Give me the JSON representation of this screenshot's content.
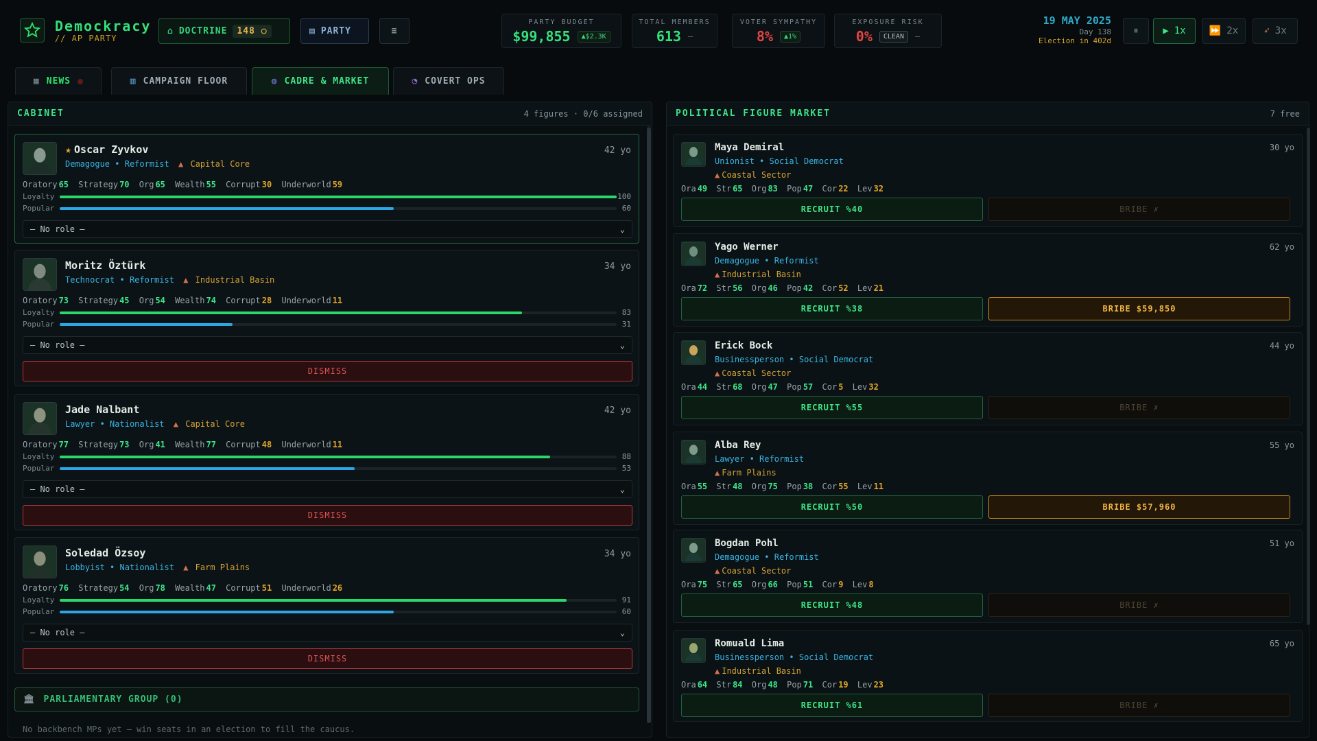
{
  "app": {
    "title": "Demockracy",
    "subtitle": "// AP PARTY"
  },
  "toolbar": {
    "doctrine_label": "DOCTRINE",
    "doctrine_points": "148",
    "party_label": "PARTY"
  },
  "stats": {
    "budget": {
      "label": "PARTY BUDGET",
      "value": "$99,855",
      "chip": "▲$2.3K"
    },
    "members": {
      "label": "TOTAL MEMBERS",
      "value": "613",
      "chip": "–"
    },
    "sympathy": {
      "label": "VOTER SYMPATHY",
      "value": "8%",
      "chip": "▲1%"
    },
    "exposure": {
      "label": "EXPOSURE RISK",
      "value": "0%",
      "chip": "CLEAN",
      "dash": "–"
    }
  },
  "date": {
    "main": "19 MAY 2025",
    "day": "Day 138",
    "election": "Election in 402d"
  },
  "speed": {
    "pause": "⏸",
    "s1": "1x",
    "s2": "2x",
    "s3": "3x"
  },
  "tabs": [
    {
      "label": "NEWS"
    },
    {
      "label": "CAMPAIGN FLOOR"
    },
    {
      "label": "CADRE & MARKET"
    },
    {
      "label": "COVERT OPS"
    }
  ],
  "cabinet": {
    "title": "CABINET",
    "meta": "4 figures · 0/6 assigned",
    "stat_labels": {
      "oratory": "Oratory",
      "strategy": "Strategy",
      "org": "Org",
      "wealth": "Wealth",
      "corrupt": "Corrupt",
      "underworld": "Underworld"
    },
    "bar_labels": {
      "loyalty": "Loyalty",
      "popular": "Popular"
    },
    "role_placeholder": "— No role —",
    "dismiss_label": "DISMISS",
    "members": [
      {
        "name": "Oscar Zyvkov",
        "age": "42 yo",
        "type": "Demagogue",
        "ideology": "Reformist",
        "region": "Capital Core",
        "oratory": "65",
        "strategy": "70",
        "org": "65",
        "wealth": "55",
        "corrupt": "30",
        "underworld": "59",
        "loyalty": 100,
        "popular": 60
      },
      {
        "name": "Moritz Öztürk",
        "age": "34 yo",
        "type": "Technocrat",
        "ideology": "Reformist",
        "region": "Industrial Basin",
        "oratory": "73",
        "strategy": "45",
        "org": "54",
        "wealth": "74",
        "corrupt": "28",
        "underworld": "11",
        "loyalty": 83,
        "popular": 31
      },
      {
        "name": "Jade Nalbant",
        "age": "42 yo",
        "type": "Lawyer",
        "ideology": "Nationalist",
        "region": "Capital Core",
        "oratory": "77",
        "strategy": "73",
        "org": "41",
        "wealth": "77",
        "corrupt": "48",
        "underworld": "11",
        "loyalty": 88,
        "popular": 53
      },
      {
        "name": "Soledad Özsoy",
        "age": "34 yo",
        "type": "Lobbyist",
        "ideology": "Nationalist",
        "region": "Farm Plains",
        "oratory": "76",
        "strategy": "54",
        "org": "78",
        "wealth": "47",
        "corrupt": "51",
        "underworld": "26",
        "loyalty": 91,
        "popular": 60
      }
    ],
    "parliamentary_group": "PARLIAMENTARY GROUP (0)",
    "parliamentary_empty": "No backbench MPs yet — win seats in an election to fill the caucus."
  },
  "market": {
    "title": "POLITICAL FIGURE MARKET",
    "meta": "7 free",
    "stat_labels": {
      "ora": "Ora",
      "str": "Str",
      "org": "Org",
      "pop": "Pop",
      "cor": "Cor",
      "lev": "Lev"
    },
    "figures": [
      {
        "name": "Maya Demiral",
        "age": "30 yo",
        "type": "Unionist",
        "ideology": "Social Democrat",
        "region": "Coastal Sector",
        "ora": "49",
        "str": "65",
        "org": "83",
        "pop": "47",
        "cor": "22",
        "lev": "32",
        "recruit": "RECRUIT %40",
        "bribe": "BRIBE ✗"
      },
      {
        "name": "Yago Werner",
        "age": "62 yo",
        "type": "Demagogue",
        "ideology": "Reformist",
        "region": "Industrial Basin",
        "ora": "72",
        "str": "56",
        "org": "46",
        "pop": "42",
        "cor": "52",
        "lev": "21",
        "recruit": "RECRUIT %38",
        "bribe": "BRIBE $59,850"
      },
      {
        "name": "Erick Bock",
        "age": "44 yo",
        "type": "Businessperson",
        "ideology": "Social Democrat",
        "region": "Coastal Sector",
        "ora": "44",
        "str": "68",
        "org": "47",
        "pop": "57",
        "cor": "5",
        "lev": "32",
        "recruit": "RECRUIT %55",
        "bribe": "BRIBE ✗"
      },
      {
        "name": "Alba Rey",
        "age": "55 yo",
        "type": "Lawyer",
        "ideology": "Reformist",
        "region": "Farm Plains",
        "ora": "55",
        "str": "48",
        "org": "75",
        "pop": "38",
        "cor": "55",
        "lev": "11",
        "recruit": "RECRUIT %50",
        "bribe": "BRIBE $57,960"
      },
      {
        "name": "Bogdan Pohl",
        "age": "51 yo",
        "type": "Demagogue",
        "ideology": "Reformist",
        "region": "Coastal Sector",
        "ora": "75",
        "str": "65",
        "org": "66",
        "pop": "51",
        "cor": "9",
        "lev": "8",
        "recruit": "RECRUIT %48",
        "bribe": "BRIBE ✗"
      },
      {
        "name": "Romuald Lima",
        "age": "65 yo",
        "type": "Businessperson",
        "ideology": "Social Democrat",
        "region": "Industrial Basin",
        "ora": "64",
        "str": "84",
        "org": "48",
        "pop": "71",
        "cor": "19",
        "lev": "23",
        "recruit": "RECRUIT %61",
        "bribe": "BRIBE ✗"
      }
    ]
  },
  "colors": {
    "accent": "#3ee589",
    "budget": "#35e07a",
    "danger": "#e05454",
    "gold": "#e0a52a",
    "info": "#38b3e3"
  }
}
